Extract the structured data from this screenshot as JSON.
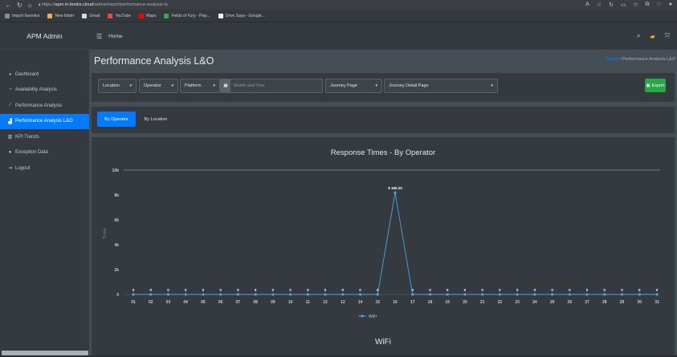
{
  "browser": {
    "url_prefix": "https://",
    "url_host": "apm.in-books.cloud",
    "url_path": "/admin/report/performance-analysis-lo",
    "favorites": [
      "Import favorites",
      "New folder",
      "Gmail",
      "YouTube",
      "Maps",
      "Fields of Fury - Play...",
      "Drive Saya - Google..."
    ]
  },
  "app": {
    "brand": "APM Admin",
    "top_home": "Home"
  },
  "sidebar": {
    "items": [
      {
        "label": "Dashboard",
        "icon": "tachometer-icon"
      },
      {
        "label": "Availability Analysis",
        "icon": "chart-pie-icon"
      },
      {
        "label": "Performance Analysis",
        "icon": "chart-line-icon"
      },
      {
        "label": "Performance Analysis L&O",
        "icon": "chart-area-icon"
      },
      {
        "label": "KPI Trends",
        "icon": "chart-bar-icon"
      },
      {
        "label": "Exception Data",
        "icon": "info-circle-icon"
      },
      {
        "label": "Logout",
        "icon": "sign-out-icon"
      }
    ],
    "active_index": 3
  },
  "page": {
    "title": "Performance Analysis L&O",
    "breadcrumb_home": "Report",
    "breadcrumb_sep": "/",
    "breadcrumb_current": "Performance Analysis L&O"
  },
  "filters": {
    "location": "Location",
    "operator": "Operator",
    "platform": "Platform",
    "month_placeholder": "Month and Year",
    "journey_page": "Journey Page",
    "journey_detail": "Journey Detail Page",
    "export_label": "Export"
  },
  "tabs": {
    "by_operator": "By Operator",
    "by_location": "By Location",
    "active": "by_operator"
  },
  "section_title": "WiFi",
  "colors": {
    "accent": "#007bff",
    "success": "#28a745",
    "series": "#4aa3df"
  },
  "chart_data": {
    "type": "line",
    "title": "Response Times - By Operator",
    "xlabel": "",
    "ylabel": "Times",
    "ylim": [
      0,
      10000
    ],
    "yticks": [
      "0",
      "2k",
      "4k",
      "6k",
      "8k",
      "10k"
    ],
    "categories": [
      "01",
      "02",
      "03",
      "04",
      "05",
      "06",
      "07",
      "08",
      "09",
      "10",
      "11",
      "12",
      "13",
      "14",
      "15",
      "16",
      "17",
      "18",
      "19",
      "20",
      "21",
      "22",
      "23",
      "24",
      "25",
      "26",
      "27",
      "28",
      "29",
      "30",
      "31"
    ],
    "series": [
      {
        "name": "WiFi",
        "values": [
          0,
          0,
          0,
          0,
          0,
          0,
          0,
          0,
          0,
          0,
          0,
          0,
          0,
          0,
          0,
          8180.25,
          0,
          0,
          0,
          0,
          0,
          0,
          0,
          0,
          0,
          0,
          0,
          0,
          0,
          0,
          0
        ]
      }
    ],
    "data_labels": [
      "0",
      "0",
      "0",
      "0",
      "0",
      "0",
      "0",
      "0",
      "0",
      "0",
      "0",
      "0",
      "0",
      "0",
      "0",
      "8 180.25",
      "0",
      "0",
      "0",
      "0",
      "0",
      "0",
      "0",
      "0",
      "0",
      "0",
      "0",
      "0",
      "0",
      "0",
      "0"
    ],
    "grid": true,
    "legend": "bottom"
  }
}
